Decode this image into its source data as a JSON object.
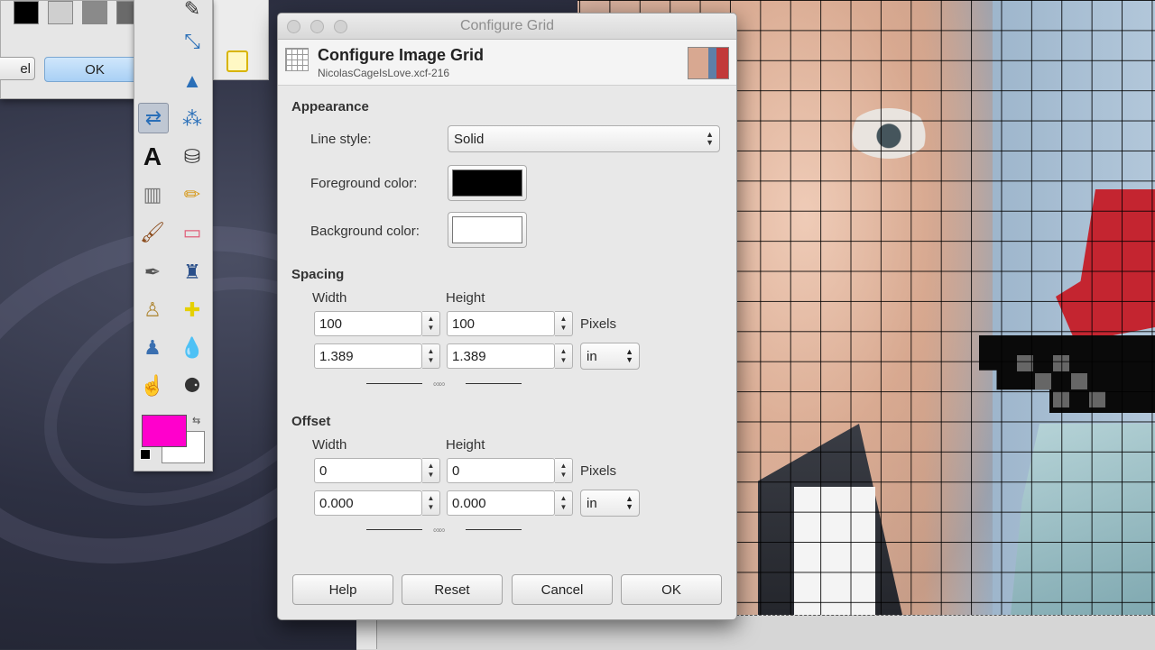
{
  "dialog": {
    "window_title": "Configure Grid",
    "header_title": "Configure Image Grid",
    "header_subtitle": "NicolasCageIsLove.xcf-216",
    "appearance": {
      "section": "Appearance",
      "line_style_label": "Line style:",
      "line_style_value": "Solid",
      "fg_label": "Foreground color:",
      "fg_color": "#000000",
      "bg_label": "Background color:",
      "bg_color": "#ffffff"
    },
    "spacing": {
      "section": "Spacing",
      "width_label": "Width",
      "height_label": "Height",
      "width_px": "100",
      "height_px": "100",
      "px_unit": "Pixels",
      "width_in": "1.389",
      "height_in": "1.389",
      "unit_value": "in"
    },
    "offset": {
      "section": "Offset",
      "width_label": "Width",
      "height_label": "Height",
      "width_px": "0",
      "height_px": "0",
      "px_unit": "Pixels",
      "width_in": "0.000",
      "height_in": "0.000",
      "unit_value": "in"
    },
    "buttons": {
      "help": "Help",
      "reset": "Reset",
      "cancel": "Cancel",
      "ok": "OK"
    }
  },
  "background_dialog": {
    "cancel_fragment": "el",
    "ok": "OK"
  },
  "toolbox": {
    "fg_color": "#ff00cc",
    "bg_color": "#ffffff",
    "text_tool_glyph": "A"
  }
}
